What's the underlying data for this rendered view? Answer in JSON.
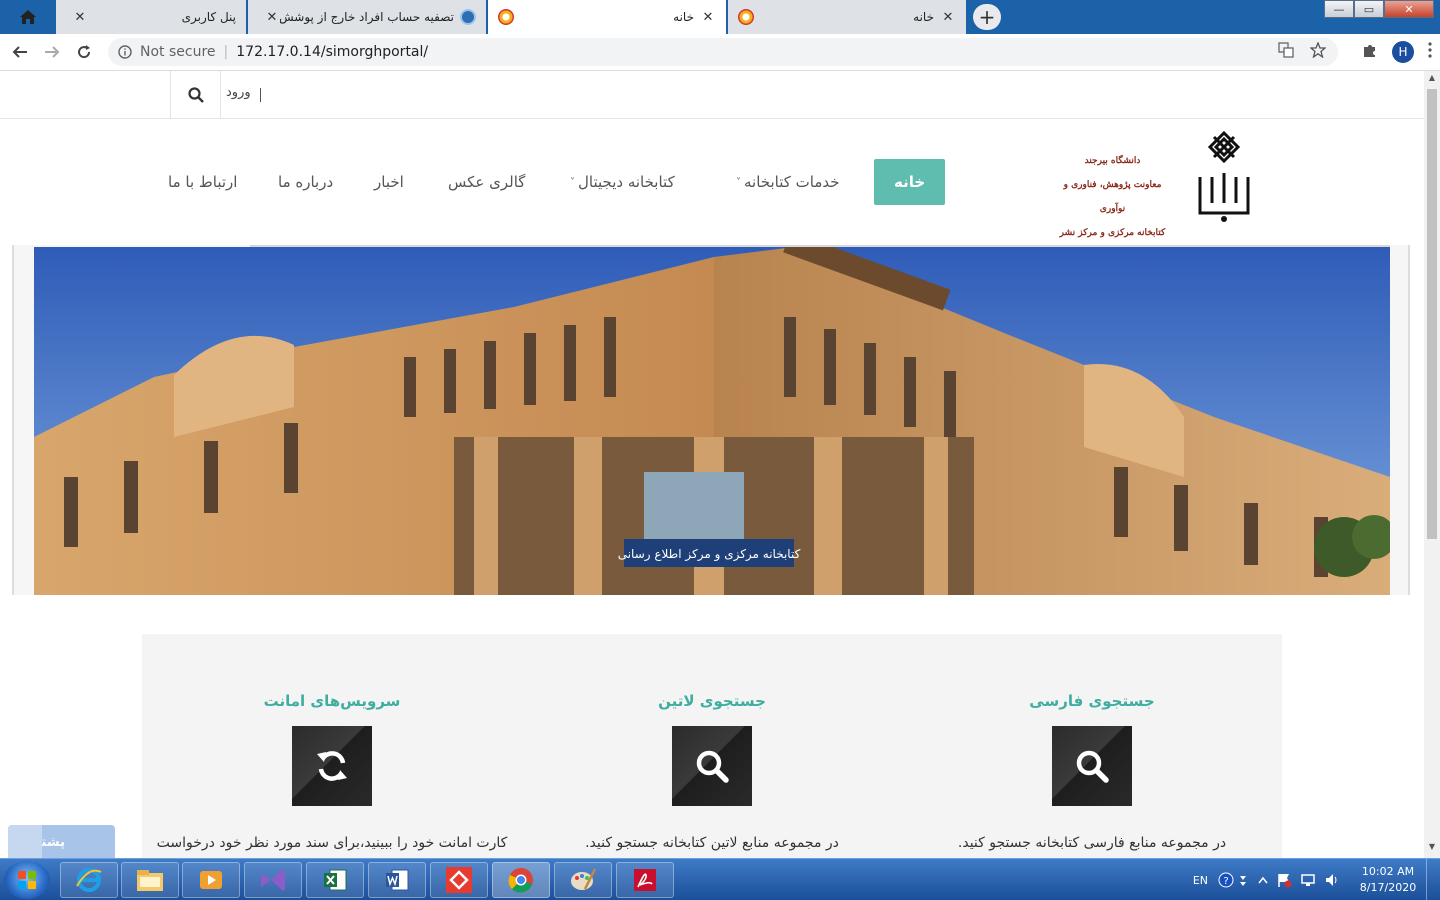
{
  "browser": {
    "tabs": [
      {
        "title": "پنل کاربری",
        "state": "inactive"
      },
      {
        "title": "تصفیه حساب افراد خارج از پوشش - سامانه",
        "state": "inactive"
      },
      {
        "title": "خانه",
        "state": "active"
      },
      {
        "title": "خانه",
        "state": "inactive"
      }
    ],
    "close_glyph": "✕",
    "new_tab_glyph": "+",
    "security_label": "Not secure",
    "url": "172.17.0.14/simorghportal/",
    "profile_initial": "H",
    "window_buttons": {
      "minimize": "—",
      "maximize": "▭",
      "close": "✕"
    }
  },
  "topbar": {
    "login_label": "ورود"
  },
  "header": {
    "logo_lines": [
      "دانشگاه بیرجند",
      "معاونت پژوهش، فناوری و نوآوری",
      "کتابخانه مرکزی و مرکز نشر"
    ],
    "menu": [
      {
        "label": "خانه",
        "active": true
      },
      {
        "label": "خدمات کتابخانه",
        "has_dropdown": true
      },
      {
        "label": "کتابخانه دیجیتال",
        "has_dropdown": true
      },
      {
        "label": "گالری عکس"
      },
      {
        "label": "اخبار"
      },
      {
        "label": "درباره ما"
      },
      {
        "label": "ارتباط با ما"
      }
    ],
    "dropdown_glyph": "˅"
  },
  "hero": {
    "sign_text": "کتابخانه مرکزی و مرکز اطلاع رسانی"
  },
  "services": [
    {
      "title": "جستجوی فارسی",
      "icon": "search-icon",
      "text": "در مجموعه منابع فارسی کتابخانه جستجو کنید."
    },
    {
      "title": "جستجوی لاتین",
      "icon": "search-icon",
      "text": "در مجموعه منابع لاتین کتابخانه جستجو کنید."
    },
    {
      "title": "سرویس‌های امانت",
      "icon": "refresh-icon",
      "text": "کارت امانت خود را ببینید،برای سند مورد نظر خود درخواست"
    }
  ],
  "support": {
    "label": "پشتیبانی"
  },
  "taskbar": {
    "language": "EN",
    "time": "10:02 AM",
    "date": "8/17/2020"
  }
}
